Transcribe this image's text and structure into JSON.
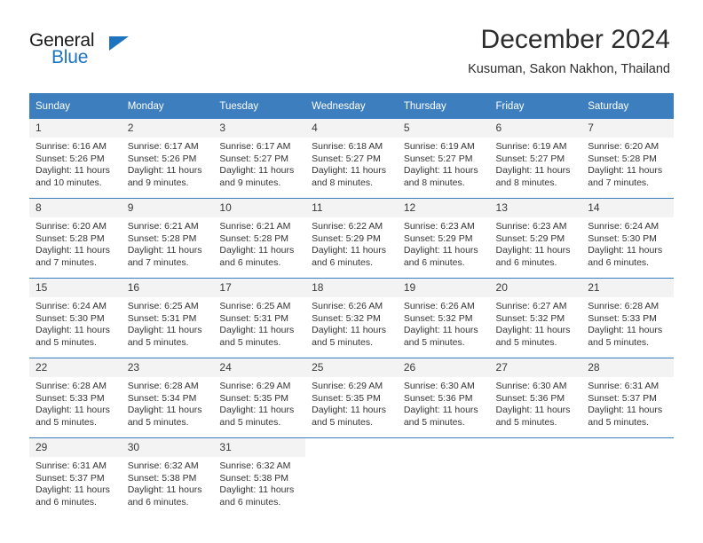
{
  "branding": {
    "name_top": "General",
    "name_bottom": "Blue"
  },
  "header": {
    "title": "December 2024",
    "subtitle": "Kusuman, Sakon Nakhon, Thailand"
  },
  "colors": {
    "header_blue": "#3d7ebf",
    "logo_blue": "#1e73be",
    "daynum_bg": "#f3f3f3",
    "text": "#333333"
  },
  "weekday_headers": [
    "Sunday",
    "Monday",
    "Tuesday",
    "Wednesday",
    "Thursday",
    "Friday",
    "Saturday"
  ],
  "weeks": [
    [
      {
        "day": "1",
        "sunrise": "Sunrise: 6:16 AM",
        "sunset": "Sunset: 5:26 PM",
        "daylight": "Daylight: 11 hours and 10 minutes."
      },
      {
        "day": "2",
        "sunrise": "Sunrise: 6:17 AM",
        "sunset": "Sunset: 5:26 PM",
        "daylight": "Daylight: 11 hours and 9 minutes."
      },
      {
        "day": "3",
        "sunrise": "Sunrise: 6:17 AM",
        "sunset": "Sunset: 5:27 PM",
        "daylight": "Daylight: 11 hours and 9 minutes."
      },
      {
        "day": "4",
        "sunrise": "Sunrise: 6:18 AM",
        "sunset": "Sunset: 5:27 PM",
        "daylight": "Daylight: 11 hours and 8 minutes."
      },
      {
        "day": "5",
        "sunrise": "Sunrise: 6:19 AM",
        "sunset": "Sunset: 5:27 PM",
        "daylight": "Daylight: 11 hours and 8 minutes."
      },
      {
        "day": "6",
        "sunrise": "Sunrise: 6:19 AM",
        "sunset": "Sunset: 5:27 PM",
        "daylight": "Daylight: 11 hours and 8 minutes."
      },
      {
        "day": "7",
        "sunrise": "Sunrise: 6:20 AM",
        "sunset": "Sunset: 5:28 PM",
        "daylight": "Daylight: 11 hours and 7 minutes."
      }
    ],
    [
      {
        "day": "8",
        "sunrise": "Sunrise: 6:20 AM",
        "sunset": "Sunset: 5:28 PM",
        "daylight": "Daylight: 11 hours and 7 minutes."
      },
      {
        "day": "9",
        "sunrise": "Sunrise: 6:21 AM",
        "sunset": "Sunset: 5:28 PM",
        "daylight": "Daylight: 11 hours and 7 minutes."
      },
      {
        "day": "10",
        "sunrise": "Sunrise: 6:21 AM",
        "sunset": "Sunset: 5:28 PM",
        "daylight": "Daylight: 11 hours and 6 minutes."
      },
      {
        "day": "11",
        "sunrise": "Sunrise: 6:22 AM",
        "sunset": "Sunset: 5:29 PM",
        "daylight": "Daylight: 11 hours and 6 minutes."
      },
      {
        "day": "12",
        "sunrise": "Sunrise: 6:23 AM",
        "sunset": "Sunset: 5:29 PM",
        "daylight": "Daylight: 11 hours and 6 minutes."
      },
      {
        "day": "13",
        "sunrise": "Sunrise: 6:23 AM",
        "sunset": "Sunset: 5:29 PM",
        "daylight": "Daylight: 11 hours and 6 minutes."
      },
      {
        "day": "14",
        "sunrise": "Sunrise: 6:24 AM",
        "sunset": "Sunset: 5:30 PM",
        "daylight": "Daylight: 11 hours and 6 minutes."
      }
    ],
    [
      {
        "day": "15",
        "sunrise": "Sunrise: 6:24 AM",
        "sunset": "Sunset: 5:30 PM",
        "daylight": "Daylight: 11 hours and 5 minutes."
      },
      {
        "day": "16",
        "sunrise": "Sunrise: 6:25 AM",
        "sunset": "Sunset: 5:31 PM",
        "daylight": "Daylight: 11 hours and 5 minutes."
      },
      {
        "day": "17",
        "sunrise": "Sunrise: 6:25 AM",
        "sunset": "Sunset: 5:31 PM",
        "daylight": "Daylight: 11 hours and 5 minutes."
      },
      {
        "day": "18",
        "sunrise": "Sunrise: 6:26 AM",
        "sunset": "Sunset: 5:32 PM",
        "daylight": "Daylight: 11 hours and 5 minutes."
      },
      {
        "day": "19",
        "sunrise": "Sunrise: 6:26 AM",
        "sunset": "Sunset: 5:32 PM",
        "daylight": "Daylight: 11 hours and 5 minutes."
      },
      {
        "day": "20",
        "sunrise": "Sunrise: 6:27 AM",
        "sunset": "Sunset: 5:32 PM",
        "daylight": "Daylight: 11 hours and 5 minutes."
      },
      {
        "day": "21",
        "sunrise": "Sunrise: 6:28 AM",
        "sunset": "Sunset: 5:33 PM",
        "daylight": "Daylight: 11 hours and 5 minutes."
      }
    ],
    [
      {
        "day": "22",
        "sunrise": "Sunrise: 6:28 AM",
        "sunset": "Sunset: 5:33 PM",
        "daylight": "Daylight: 11 hours and 5 minutes."
      },
      {
        "day": "23",
        "sunrise": "Sunrise: 6:28 AM",
        "sunset": "Sunset: 5:34 PM",
        "daylight": "Daylight: 11 hours and 5 minutes."
      },
      {
        "day": "24",
        "sunrise": "Sunrise: 6:29 AM",
        "sunset": "Sunset: 5:35 PM",
        "daylight": "Daylight: 11 hours and 5 minutes."
      },
      {
        "day": "25",
        "sunrise": "Sunrise: 6:29 AM",
        "sunset": "Sunset: 5:35 PM",
        "daylight": "Daylight: 11 hours and 5 minutes."
      },
      {
        "day": "26",
        "sunrise": "Sunrise: 6:30 AM",
        "sunset": "Sunset: 5:36 PM",
        "daylight": "Daylight: 11 hours and 5 minutes."
      },
      {
        "day": "27",
        "sunrise": "Sunrise: 6:30 AM",
        "sunset": "Sunset: 5:36 PM",
        "daylight": "Daylight: 11 hours and 5 minutes."
      },
      {
        "day": "28",
        "sunrise": "Sunrise: 6:31 AM",
        "sunset": "Sunset: 5:37 PM",
        "daylight": "Daylight: 11 hours and 5 minutes."
      }
    ],
    [
      {
        "day": "29",
        "sunrise": "Sunrise: 6:31 AM",
        "sunset": "Sunset: 5:37 PM",
        "daylight": "Daylight: 11 hours and 6 minutes."
      },
      {
        "day": "30",
        "sunrise": "Sunrise: 6:32 AM",
        "sunset": "Sunset: 5:38 PM",
        "daylight": "Daylight: 11 hours and 6 minutes."
      },
      {
        "day": "31",
        "sunrise": "Sunrise: 6:32 AM",
        "sunset": "Sunset: 5:38 PM",
        "daylight": "Daylight: 11 hours and 6 minutes."
      },
      {
        "day": "",
        "sunrise": "",
        "sunset": "",
        "daylight": ""
      },
      {
        "day": "",
        "sunrise": "",
        "sunset": "",
        "daylight": ""
      },
      {
        "day": "",
        "sunrise": "",
        "sunset": "",
        "daylight": ""
      },
      {
        "day": "",
        "sunrise": "",
        "sunset": "",
        "daylight": ""
      }
    ]
  ]
}
